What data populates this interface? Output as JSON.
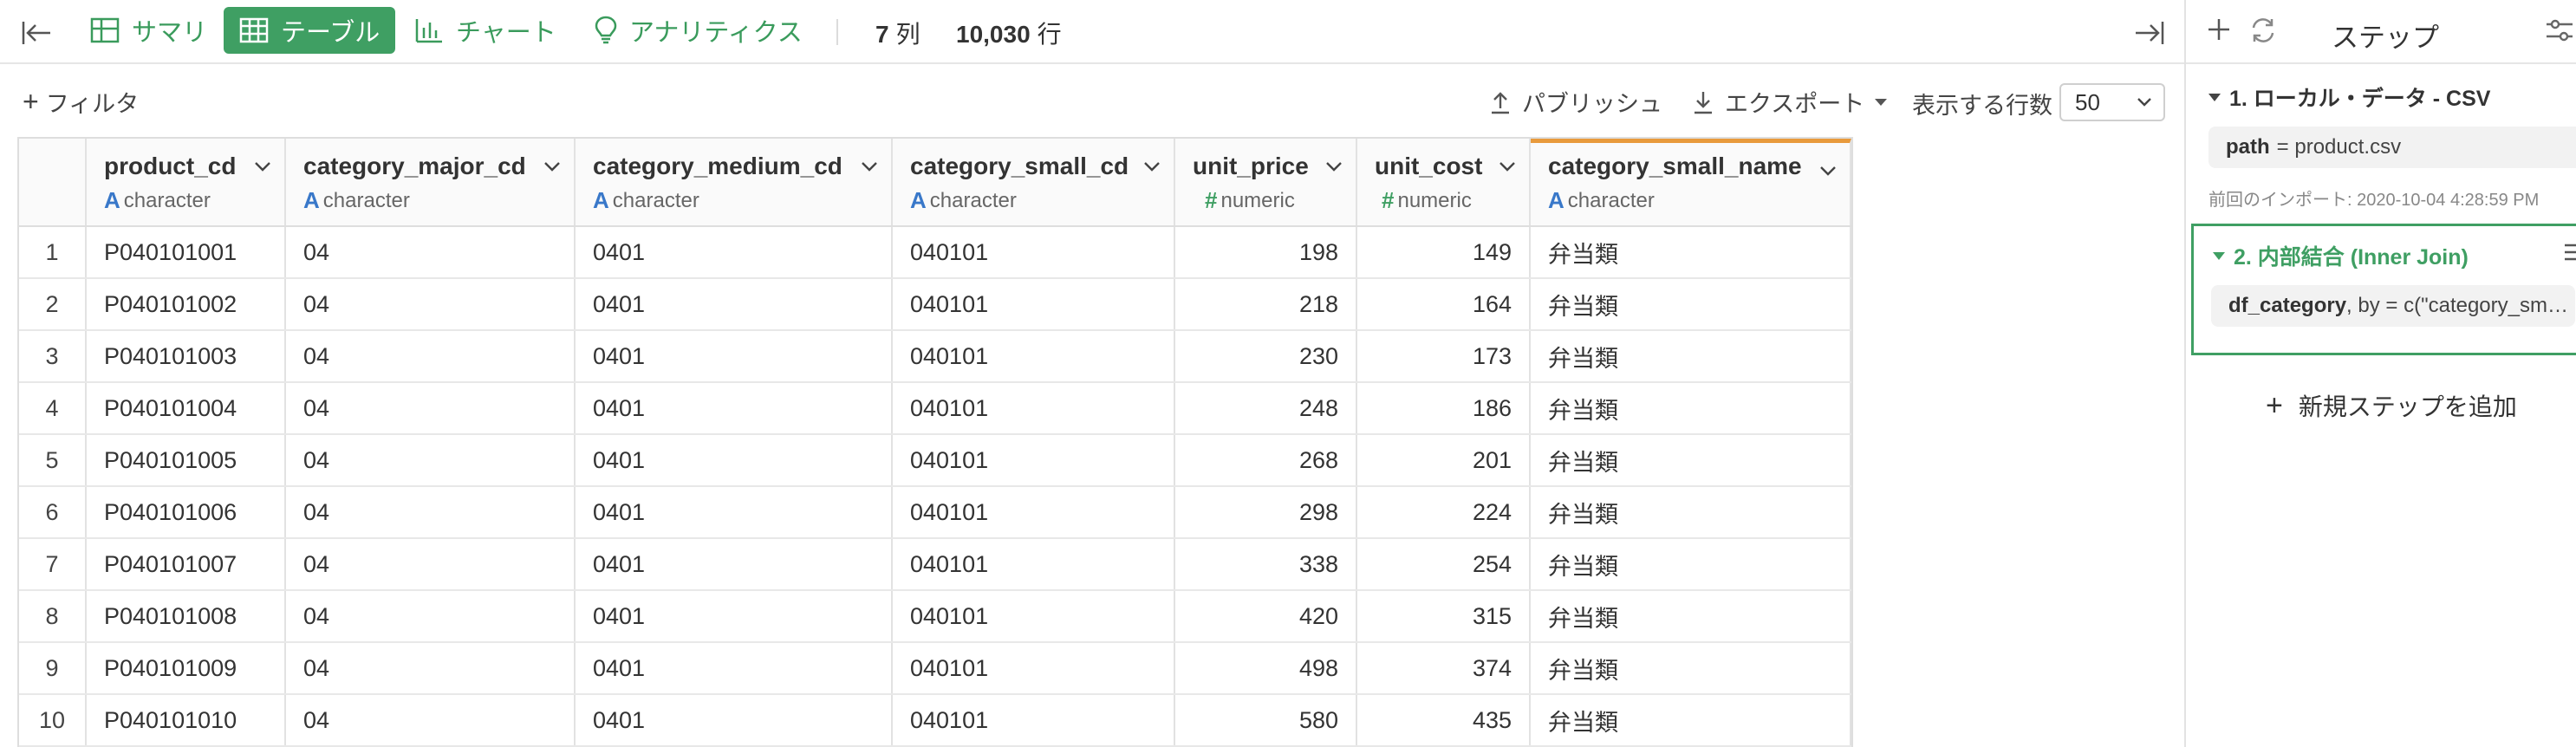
{
  "toolbar": {
    "tabs": [
      {
        "label": "サマリ",
        "active": false,
        "icon": "summary-grid-icon"
      },
      {
        "label": "テーブル",
        "active": true,
        "icon": "table-grid-icon"
      },
      {
        "label": "チャート",
        "active": false,
        "icon": "bar-chart-icon"
      },
      {
        "label": "アナリティクス",
        "active": false,
        "icon": "lightbulb-icon"
      }
    ],
    "columns_count": "7",
    "columns_unit": "列",
    "rows_count": "10,030",
    "rows_unit": "行"
  },
  "subbar": {
    "filter_label": "フィルタ",
    "publish_label": "パブリッシュ",
    "export_label": "エクスポート",
    "rows_label": "表示する行数",
    "rows_value": "50"
  },
  "table": {
    "columns": [
      {
        "name": "product_cd",
        "type": "character",
        "type_glyph": "A"
      },
      {
        "name": "category_major_cd",
        "type": "character",
        "type_glyph": "A"
      },
      {
        "name": "category_medium_cd",
        "type": "character",
        "type_glyph": "A"
      },
      {
        "name": "category_small_cd",
        "type": "character",
        "type_glyph": "A"
      },
      {
        "name": "unit_price",
        "type": "numeric",
        "type_glyph": "#"
      },
      {
        "name": "unit_cost",
        "type": "numeric",
        "type_glyph": "#"
      },
      {
        "name": "category_small_name",
        "type": "character",
        "type_glyph": "A"
      }
    ],
    "rows": [
      [
        "1",
        "P040101001",
        "04",
        "0401",
        "040101",
        "198",
        "149",
        "弁当類"
      ],
      [
        "2",
        "P040101002",
        "04",
        "0401",
        "040101",
        "218",
        "164",
        "弁当類"
      ],
      [
        "3",
        "P040101003",
        "04",
        "0401",
        "040101",
        "230",
        "173",
        "弁当類"
      ],
      [
        "4",
        "P040101004",
        "04",
        "0401",
        "040101",
        "248",
        "186",
        "弁当類"
      ],
      [
        "5",
        "P040101005",
        "04",
        "0401",
        "040101",
        "268",
        "201",
        "弁当類"
      ],
      [
        "6",
        "P040101006",
        "04",
        "0401",
        "040101",
        "298",
        "224",
        "弁当類"
      ],
      [
        "7",
        "P040101007",
        "04",
        "0401",
        "040101",
        "338",
        "254",
        "弁当類"
      ],
      [
        "8",
        "P040101008",
        "04",
        "0401",
        "040101",
        "420",
        "315",
        "弁当類"
      ],
      [
        "9",
        "P040101009",
        "04",
        "0401",
        "040101",
        "498",
        "374",
        "弁当類"
      ],
      [
        "10",
        "P040101010",
        "04",
        "0401",
        "040101",
        "580",
        "435",
        "弁当類"
      ]
    ]
  },
  "steps": {
    "title": "ステップ",
    "items": [
      {
        "title": "1. ローカル・データ - CSV",
        "code_key": "path",
        "code_rest": "= product.csv",
        "meta": "前回のインポート: 2020-10-04 4:28:59 PM"
      },
      {
        "title": "2. 内部結合 (Inner Join)",
        "code_key": "df_category",
        "code_rest": ", by = c(\"category_sm…"
      }
    ],
    "add_label": "新規ステップを追加"
  },
  "colors": {
    "accent_green": "#3f9f63",
    "character_blue": "#3978c9",
    "selected_column_orange": "#e89a3c"
  }
}
